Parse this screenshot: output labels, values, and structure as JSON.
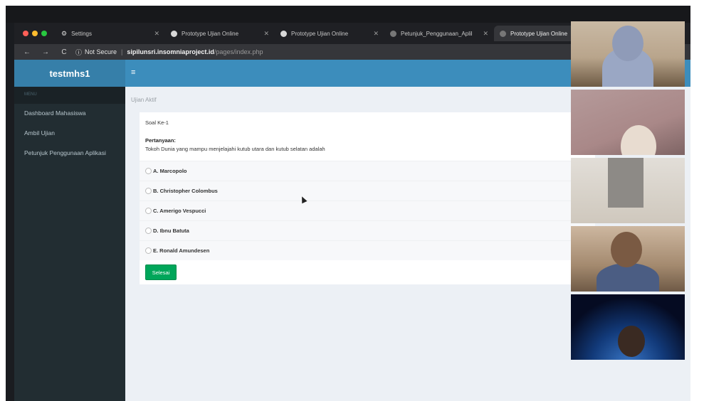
{
  "browser": {
    "tabs": [
      {
        "label": "Settings"
      },
      {
        "label": "Prototype Ujian Online"
      },
      {
        "label": "Prototype Ujian Online"
      },
      {
        "label": "Petunjuk_Penggunaan_Aplikasi"
      },
      {
        "label": "Prototype Ujian Online"
      }
    ],
    "security": "Not Secure",
    "url_host": "sipilunsri.insomniaproject.id",
    "url_path": "/pages/index.php"
  },
  "app": {
    "brand": "testmhs1",
    "menu_header": "MENU",
    "menu": [
      {
        "label": "Dashboard Mahasiswa"
      },
      {
        "label": "Ambil Ujian"
      },
      {
        "label": "Petunjuk Penggunaan Aplikasi"
      }
    ],
    "toggle_icon": "hamburger-icon"
  },
  "exam": {
    "breadcrumb": "Ujian Aktif",
    "question_number": "Soal Ke-1",
    "question_label": "Pertanyaan:",
    "question_text": "Tokoh Dunia yang mampu menjelajahi kutub utara dan kutub selatan adalah",
    "options": [
      {
        "label": "A. Marcopolo"
      },
      {
        "label": "B. Christopher Colombus"
      },
      {
        "label": "C. Amerigo Vespucci"
      },
      {
        "label": "D. Ibnu Batuta"
      },
      {
        "label": "E. Ronald Amundesen"
      }
    ],
    "submit_label": "Selesai"
  },
  "colors": {
    "brand_bg": "#367fa9",
    "navbar_bg": "#3c8dbc",
    "sidebar_bg": "#222d32",
    "submit_bg": "#00a65a"
  }
}
